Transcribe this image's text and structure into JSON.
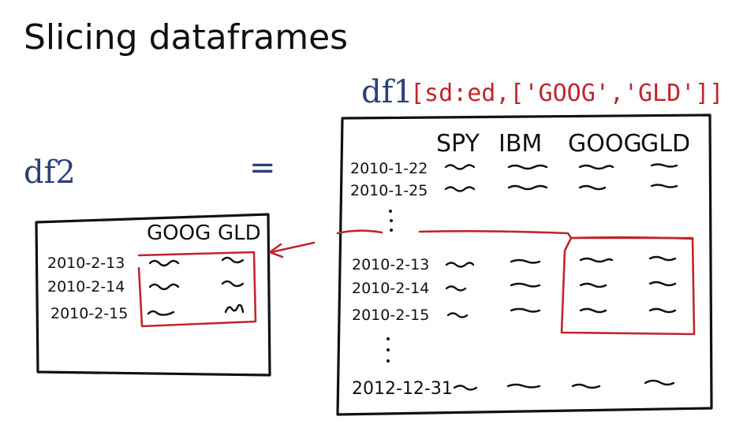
{
  "title": "Slicing dataframes",
  "colors": {
    "ink": "#111111",
    "blue": "#2b3f7a",
    "red": "#c0262c"
  },
  "result_frame": {
    "label": "df2",
    "equals": "=",
    "columns": [
      "GOOG",
      "GLD"
    ],
    "rows": [
      "2010-2-13",
      "2010-2-14",
      "2010-2-15"
    ]
  },
  "source_frame": {
    "name": "df1",
    "slice_expr": "[sd:ed,['GOOG','GLD']]",
    "columns": [
      "SPY",
      "IBM",
      "GOOG",
      "GLD"
    ],
    "top_rows": [
      "2010-1-22",
      "2010-1-25"
    ],
    "selected_rows": [
      "2010-2-13",
      "2010-2-14",
      "2010-2-15"
    ],
    "last_row": "2012-12-31"
  },
  "icons": {
    "arrow": "arrow-left-icon",
    "ellipsis": "vertical-ellipsis-icon"
  }
}
